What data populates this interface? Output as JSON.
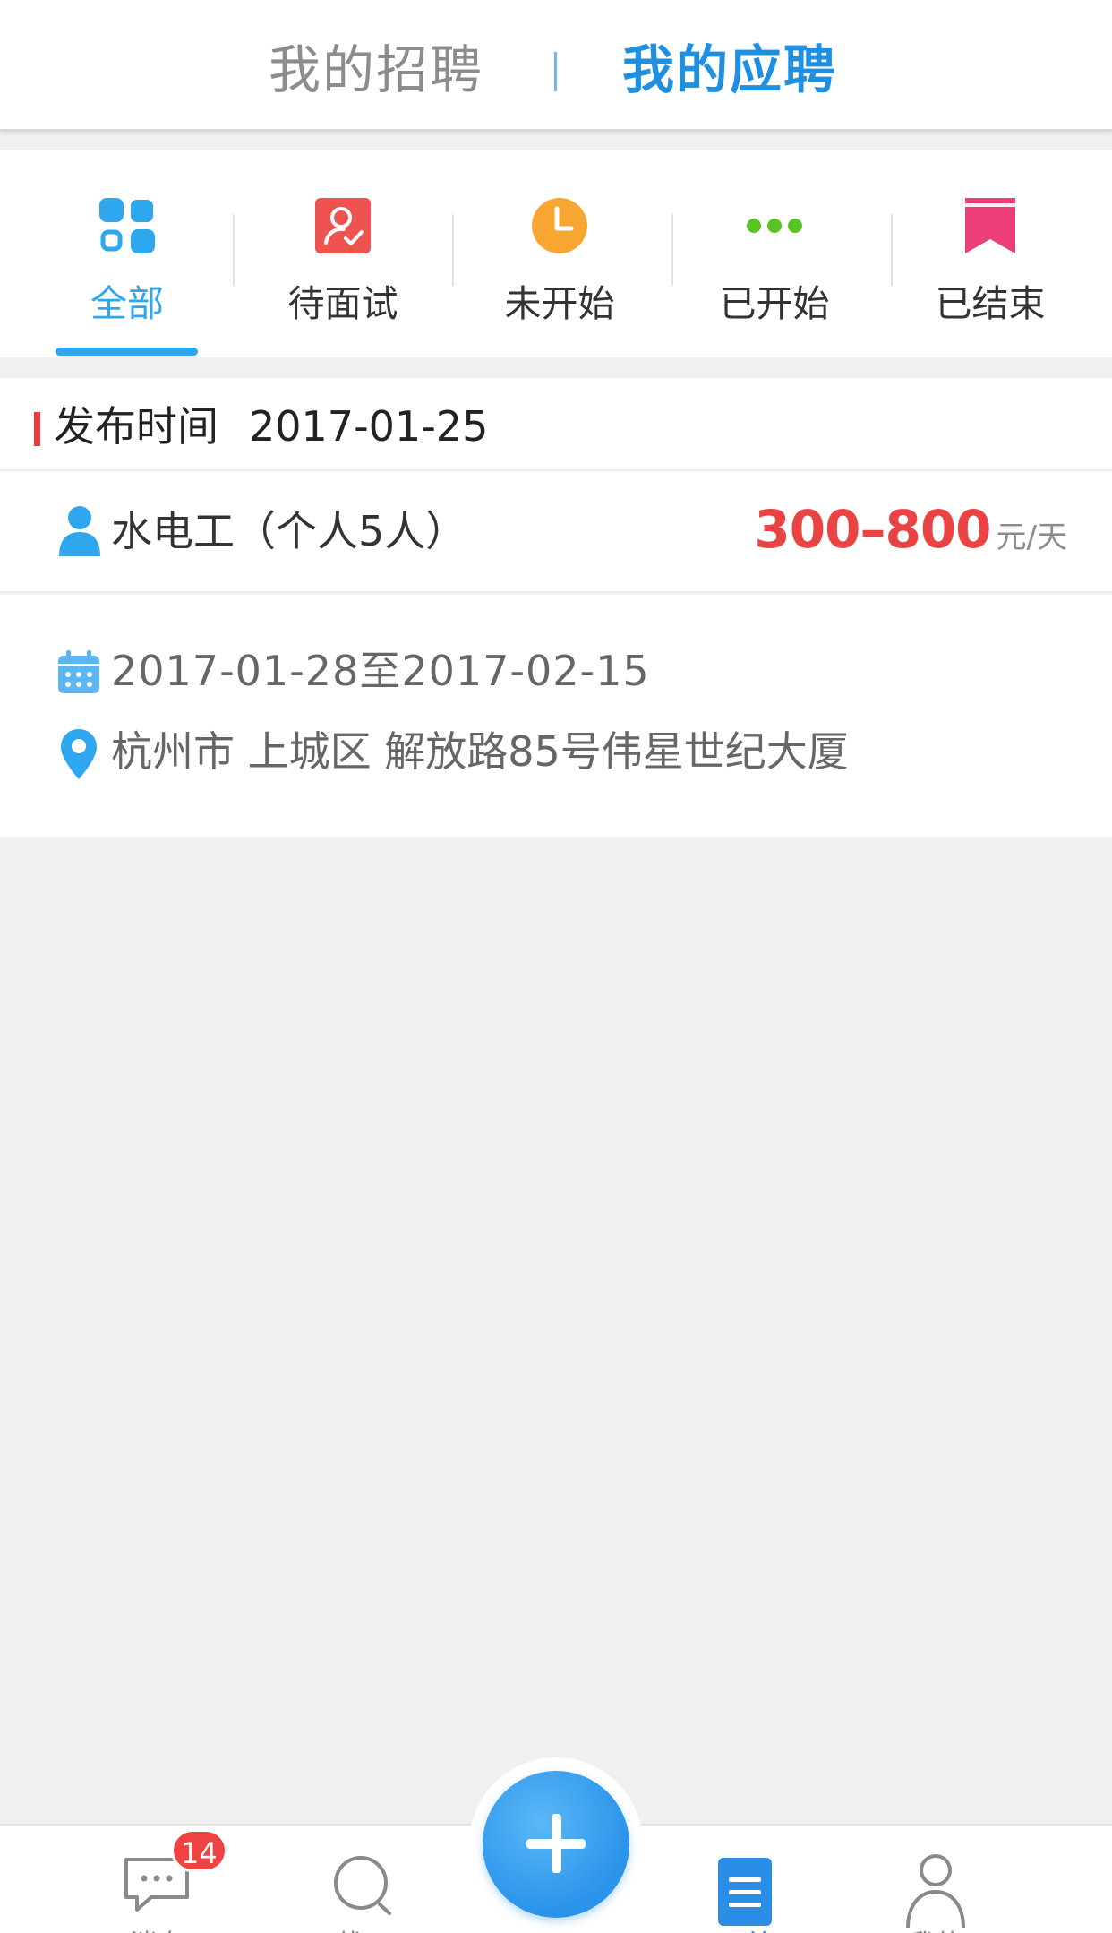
{
  "header": {
    "tab_recruit": "我的招聘",
    "tab_apply": "我的应聘",
    "active_tab": "我的应聘"
  },
  "filters": [
    {
      "label": "全部",
      "icon": "grid-icon",
      "color": "#2ea7ee",
      "active": true
    },
    {
      "label": "待面试",
      "icon": "interview-icon",
      "color": "#ef5350"
    },
    {
      "label": "未开始",
      "icon": "clock-icon",
      "color": "#f7a731"
    },
    {
      "label": "已开始",
      "icon": "dots-icon",
      "color": "#58c322"
    },
    {
      "label": "已结束",
      "icon": "bookmark-icon",
      "color": "#ec3e78"
    }
  ],
  "job": {
    "publish_label": "发布时间",
    "publish_date": "2017-01-25",
    "title": "水电工（个人5人）",
    "salary": "300–800",
    "salary_unit": "元/天",
    "date_range": "2017-01-28至2017-02-15",
    "location": "杭州市 上城区 解放路85号伟星世纪大厦"
  },
  "bottom_nav": {
    "items": [
      {
        "label": "消息",
        "icon": "chat-icon",
        "badge": "14"
      },
      {
        "label": "找工",
        "icon": "search-icon"
      },
      {
        "label": "工单",
        "icon": "order-list-icon",
        "active": true
      },
      {
        "label": "我的",
        "icon": "user-icon"
      }
    ],
    "fab_icon": "plus-icon"
  },
  "colors": {
    "accent": "#1e8fe1",
    "salary": "#ea4343",
    "marker": "#ea3c3c"
  }
}
